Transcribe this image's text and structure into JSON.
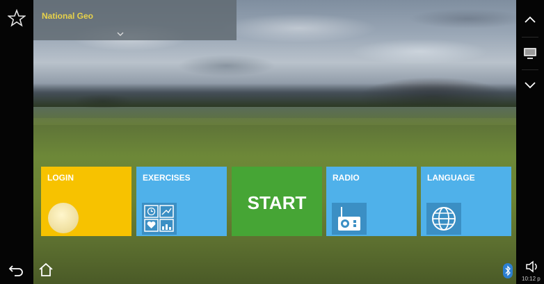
{
  "overlay": {
    "station_name": "National Geo"
  },
  "tiles": {
    "login": {
      "label": "LOGIN"
    },
    "exercises": {
      "label": "EXERCISES"
    },
    "start": {
      "label": "START"
    },
    "radio": {
      "label": "RADIO"
    },
    "language": {
      "label": "LANGUAGE"
    }
  },
  "status": {
    "clock": "10:12 p"
  },
  "colors": {
    "login": "#f7c200",
    "exercises": "#4fb1ea",
    "start": "#46a535",
    "radio": "#4fb1ea",
    "language": "#4fb1ea"
  },
  "icons": {
    "left_top": "star-icon",
    "right_top": "chevron-up-icon",
    "right_mid": "monitor-icon",
    "right_lower": "chevron-down-icon",
    "bottom_left": [
      "back-icon",
      "home-icon"
    ],
    "bottom_right": [
      "bluetooth-icon",
      "volume-icon"
    ]
  }
}
